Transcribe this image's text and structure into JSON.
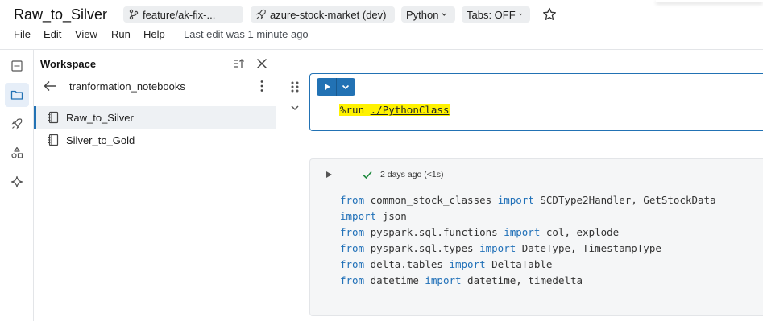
{
  "header": {
    "title": "Raw_to_Silver",
    "branch": "feature/ak-fix-...",
    "cluster": "azure-stock-market (dev)",
    "language": "Python",
    "tabs": "Tabs: OFF",
    "menu": [
      "File",
      "Edit",
      "View",
      "Run",
      "Help"
    ],
    "last_edit": "Last edit was 1 minute ago"
  },
  "rail": {
    "icons": [
      "list-icon",
      "folder-icon",
      "rocket-icon",
      "shapes-icon",
      "sparkle-icon"
    ],
    "active": "folder-icon"
  },
  "workspace": {
    "title": "Workspace",
    "folder": "tranformation_notebooks",
    "items": [
      {
        "label": "Raw_to_Silver",
        "active": true
      },
      {
        "label": "Silver_to_Gold",
        "active": false
      }
    ]
  },
  "cells": {
    "cell1": {
      "magic": "%run",
      "path": "./PythonClass"
    },
    "cell2": {
      "status": "2 days ago (<1s)",
      "lines": [
        [
          {
            "t": "from",
            "k": true
          },
          {
            "t": " common_stock_classes "
          },
          {
            "t": "import",
            "k": true
          },
          {
            "t": " SCDType2Handler, GetStockData"
          }
        ],
        [
          {
            "t": "import",
            "k": true
          },
          {
            "t": " json"
          }
        ],
        [
          {
            "t": "from",
            "k": true
          },
          {
            "t": " pyspark.sql.functions "
          },
          {
            "t": "import",
            "k": true
          },
          {
            "t": " col, explode"
          }
        ],
        [
          {
            "t": "from",
            "k": true
          },
          {
            "t": " pyspark.sql.types "
          },
          {
            "t": "import",
            "k": true
          },
          {
            "t": " DateType, TimestampType"
          }
        ],
        [
          {
            "t": "from",
            "k": true
          },
          {
            "t": " delta.tables "
          },
          {
            "t": "import",
            "k": true
          },
          {
            "t": " DeltaTable"
          }
        ],
        [
          {
            "t": "from",
            "k": true
          },
          {
            "t": " datetime "
          },
          {
            "t": "import",
            "k": true
          },
          {
            "t": " datetime, timedelta"
          }
        ]
      ]
    }
  },
  "colors": {
    "accent": "#2272b4",
    "keyword": "#2070b8",
    "highlight": "#fff200",
    "success": "#1e8a3e"
  }
}
